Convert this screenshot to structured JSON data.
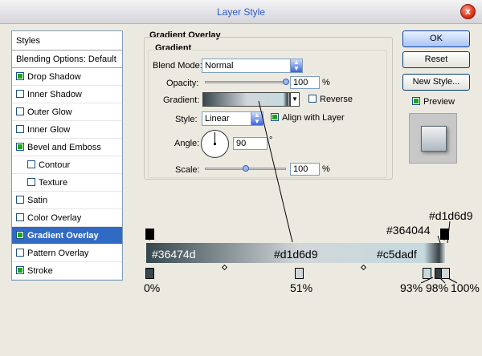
{
  "window": {
    "title": "Layer Style",
    "close_glyph": "x"
  },
  "styles_list": {
    "header": "Styles",
    "items": [
      {
        "label": "Blending Options: Default",
        "checkbox": false,
        "checked": false,
        "bold": true
      },
      {
        "label": "Drop Shadow",
        "checkbox": true,
        "checked": true
      },
      {
        "label": "Inner Shadow",
        "checkbox": true,
        "checked": false
      },
      {
        "label": "Outer Glow",
        "checkbox": true,
        "checked": false
      },
      {
        "label": "Inner Glow",
        "checkbox": true,
        "checked": false
      },
      {
        "label": "Bevel and Emboss",
        "checkbox": true,
        "checked": true
      },
      {
        "label": "Contour",
        "checkbox": true,
        "checked": false,
        "sub": true
      },
      {
        "label": "Texture",
        "checkbox": true,
        "checked": false,
        "sub": true
      },
      {
        "label": "Satin",
        "checkbox": true,
        "checked": false
      },
      {
        "label": "Color Overlay",
        "checkbox": true,
        "checked": false
      },
      {
        "label": "Gradient Overlay",
        "checkbox": true,
        "checked": true,
        "selected": true
      },
      {
        "label": "Pattern Overlay",
        "checkbox": true,
        "checked": false
      },
      {
        "label": "Stroke",
        "checkbox": true,
        "checked": true
      }
    ]
  },
  "gradient_overlay": {
    "section_title": "Gradient Overlay",
    "group_title": "Gradient",
    "blend_mode": {
      "label": "Blend Mode:",
      "value": "Normal"
    },
    "opacity": {
      "label": "Opacity:",
      "value": "100",
      "unit": "%",
      "fraction": 1.0
    },
    "gradient": {
      "label": "Gradient:"
    },
    "reverse": {
      "label": "Reverse",
      "checked": false
    },
    "style": {
      "label": "Style:",
      "value": "Linear"
    },
    "align_with_layer": {
      "label": "Align with Layer",
      "checked": true
    },
    "angle": {
      "label": "Angle:",
      "value": "90",
      "unit": "°"
    },
    "scale": {
      "label": "Scale:",
      "value": "100",
      "unit": "%",
      "fraction": 0.5
    }
  },
  "buttons": {
    "ok": "OK",
    "reset": "Reset",
    "new_style": "New Style...",
    "preview": "Preview",
    "preview_checked": true
  },
  "gradient_editor": {
    "bar_labels": [
      "#36474d",
      "#d1d6d9",
      "#c5dadf"
    ],
    "top_labels": [
      "#364044",
      "#d1d6d9"
    ],
    "stop_labels": [
      "0%",
      "51%",
      "93%",
      "98%",
      "100%"
    ],
    "colors": {
      "c0": "#36474d",
      "c51": "#d1d6d9",
      "c93": "#c5dadf",
      "c98": "#364044",
      "c100": "#d1d6d9"
    }
  },
  "colors": {
    "accent": "#316ac5",
    "title": "#2b5bc8",
    "close": "#d8341a"
  }
}
